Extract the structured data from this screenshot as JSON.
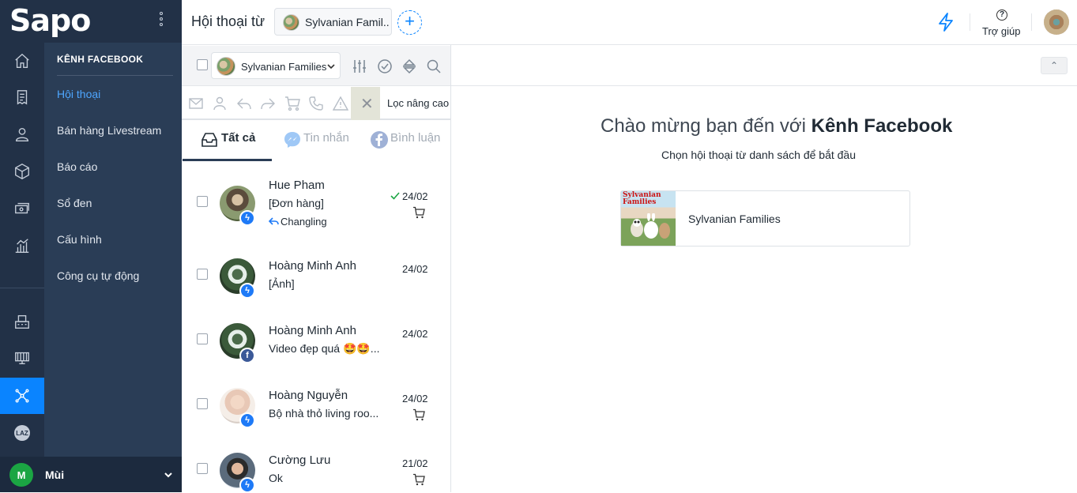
{
  "app": {
    "logo": "Sapo"
  },
  "nav": {
    "heading": "KÊNH FACEBOOK",
    "items": [
      {
        "label": "Hội thoại",
        "active": true
      },
      {
        "label": "Bán hàng Livestream"
      },
      {
        "label": "Báo cáo"
      },
      {
        "label": "Sổ đen"
      },
      {
        "label": "Cấu hình"
      },
      {
        "label": "Công cụ tự động"
      }
    ],
    "rail_icons": [
      "home-icon",
      "orders-icon",
      "customer-icon",
      "product-icon",
      "cashbook-icon",
      "report-icon",
      "pos-icon",
      "store-icon",
      "channel-icon",
      "lazada-icon"
    ],
    "lazada_label": "LAZ"
  },
  "user": {
    "initial": "M",
    "name": "Mùi"
  },
  "header": {
    "title": "Hội thoại từ",
    "page_chip": "Sylvanian Famil..",
    "add_label": "+",
    "help_icon": "?",
    "help_label": "Trợ giúp",
    "accent": "#0a84ff"
  },
  "list": {
    "page_select": "Sylvanian Families",
    "clear_label": "✕",
    "advanced_filter": "Lọc nâng cao",
    "tabs": [
      {
        "label": "Tất cả",
        "active": true
      },
      {
        "label": "Tin nhắn"
      },
      {
        "label": "Bình luận"
      }
    ],
    "conversations": [
      {
        "name": "Hue Pham",
        "snippet": "[Đơn hàng]",
        "reply": "Changling",
        "date": "24/02",
        "source": "messenger",
        "replied": true,
        "cart": true
      },
      {
        "name": "Hoàng Minh Anh",
        "snippet": "[Ảnh]",
        "date": "24/02",
        "source": "messenger"
      },
      {
        "name": "Hoàng Minh Anh",
        "snippet": "Video đẹp quá 🤩🤩...",
        "date": "24/02",
        "source": "facebook"
      },
      {
        "name": "Hoàng Nguyễn",
        "snippet": "Bộ nhà thỏ living roo...",
        "date": "24/02",
        "source": "messenger",
        "cart": true
      },
      {
        "name": "Cường Lưu",
        "snippet": "Ok",
        "date": "21/02",
        "source": "messenger",
        "cart": true
      }
    ]
  },
  "main": {
    "collapse_label": "⌃",
    "welcome_prefix": "Chào mừng bạn đến với ",
    "welcome_brand": "Kênh Facebook",
    "subtitle": "Chọn hội thoại từ danh sách để bắt đầu",
    "page_card_name": "Sylvanian Families",
    "thumb_title_1": "Sylvanian",
    "thumb_title_2": "Families"
  }
}
